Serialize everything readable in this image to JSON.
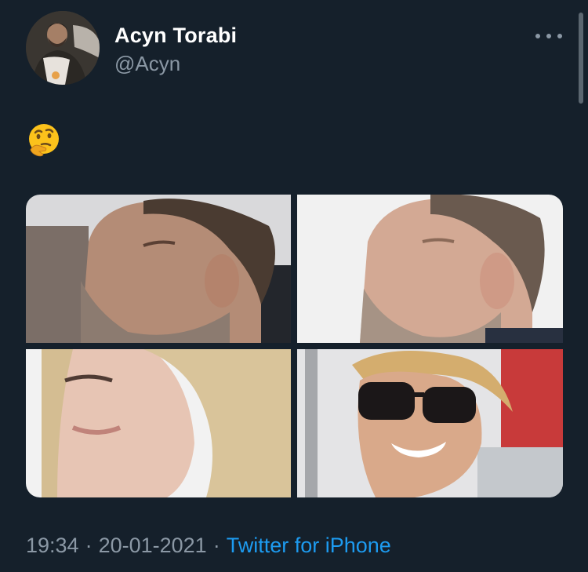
{
  "author": {
    "name": "Acyn Torabi",
    "handle": "@Acyn"
  },
  "tweet": {
    "emoji_icon": "thinking-face-emoji",
    "media_count": 4
  },
  "meta": {
    "time": "19:34",
    "separator": "·",
    "date": "20-01-2021",
    "source": "Twitter for iPhone"
  },
  "colors": {
    "background": "#15202b",
    "primary_text": "#ffffff",
    "secondary_text": "#8b98a5",
    "link": "#1d9bf0"
  }
}
